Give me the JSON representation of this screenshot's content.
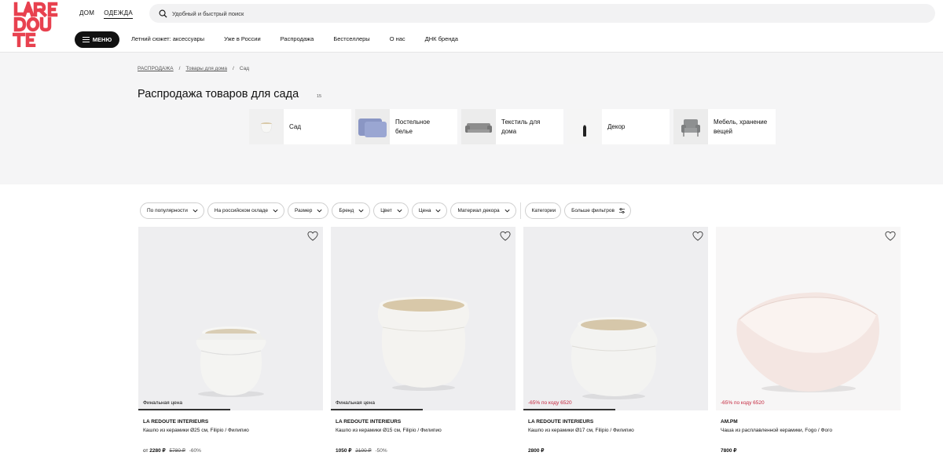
{
  "header": {
    "logo_text": "LA REDOUTE",
    "top_tabs": [
      "ДОМ",
      "ОДЕЖДА"
    ],
    "search_placeholder": "Удобный и быстрый поиск",
    "menu_label": "МЕНЮ",
    "nav": [
      "Летний сюжет: аксессуары",
      "Уже в России",
      "Распродажа",
      "Бестселлеры",
      "О нас",
      "ДНК бренда"
    ]
  },
  "breadcrumb": {
    "items": [
      "РАСПРОДАЖА",
      "Товары для дома",
      "Сад"
    ],
    "separator": "/"
  },
  "page": {
    "title": "Распродажа товаров для сада",
    "count": "15"
  },
  "categories": [
    {
      "label": "Сад",
      "icon": "pot-icon"
    },
    {
      "label": "Постельное белье",
      "icon": "pillow-icon"
    },
    {
      "label": "Текстиль для дома",
      "icon": "sofa-icon"
    },
    {
      "label": "Декор",
      "icon": "vase-icon"
    },
    {
      "label": "Мебель, хранение вещей",
      "icon": "armchair-icon"
    }
  ],
  "filters": [
    "По популярности",
    "На российском складе",
    "Размер",
    "Бренд",
    "Цвет",
    "Цена",
    "Материал декора"
  ],
  "filters_extra": {
    "categories": "Категории",
    "more": "Больше фильтров"
  },
  "products": [
    {
      "badge": "Финальная цена",
      "badge_type": "final",
      "brand": "LA REDOUTE INTERIEURS",
      "name": "Кашпо из керамики Ø25 см, Filipio / Филипио",
      "price_prefix": "от",
      "price": "2280 ₽",
      "old_price": "5780 ₽",
      "discount": "-60%"
    },
    {
      "badge": "Финальная цена",
      "badge_type": "final",
      "brand": "LA REDOUTE INTERIEURS",
      "name": "Кашпо из керамики Ø15 см, Filipio / Филипио",
      "price_prefix": "",
      "price": "1050 ₽",
      "old_price": "2100 ₽",
      "discount": "-50%"
    },
    {
      "badge": "-65% по коду 6520",
      "badge_type": "promo",
      "brand": "LA REDOUTE INTERIEURS",
      "name": "Кашпо из керамики Ø17 см, Filipio / Филипио",
      "price_prefix": "",
      "price": "2800 ₽",
      "old_price": "",
      "discount": ""
    },
    {
      "badge": "-65% по коду 6520",
      "badge_type": "promo",
      "brand": "AM.PM",
      "name": "Чаша из расплавленной керамики, Fogo / Фого",
      "price_prefix": "",
      "price": "7800 ₽",
      "old_price": "",
      "discount": ""
    }
  ],
  "colors": {
    "logo_red": "#e8414f",
    "promo_red": "#c4263d",
    "grey_bg": "#f5f5f6",
    "dark": "#111111"
  }
}
